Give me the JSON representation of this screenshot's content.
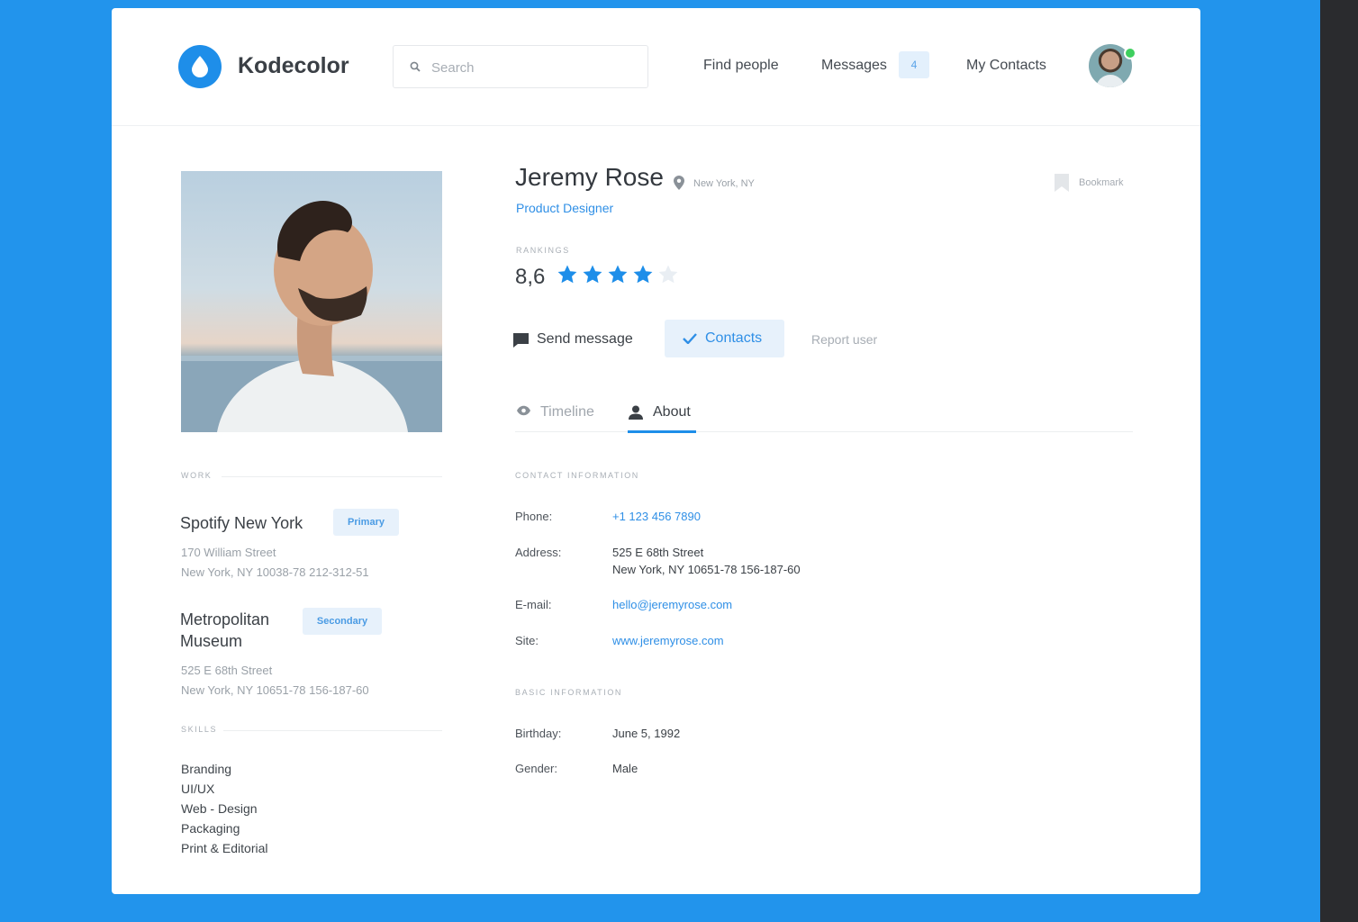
{
  "header": {
    "brand": "Kodecolor",
    "search_placeholder": "Search",
    "nav": {
      "find_people": "Find people",
      "messages": "Messages",
      "messages_count": "4",
      "my_contacts": "My Contacts"
    }
  },
  "profile": {
    "name": "Jeremy Rose",
    "location": "New York, NY",
    "job_title": "Product Designer",
    "bookmark_label": "Bookmark",
    "rankings_label": "RANKINGS",
    "ranking_value": "8,6",
    "stars_filled": 4,
    "stars_total": 5
  },
  "actions": {
    "send_message": "Send message",
    "contacts": "Contacts",
    "report_user": "Report user"
  },
  "tabs": [
    {
      "label": "Timeline",
      "active": false
    },
    {
      "label": "About",
      "active": true
    }
  ],
  "work": {
    "label": "WORK",
    "items": [
      {
        "name": "Spotify New York",
        "tag": "Primary",
        "address_line1": "170 William Street",
        "address_line2": "New York, NY 10038-78 212-312-51"
      },
      {
        "name_line1": "Metropolitan",
        "name_line2": "Museum",
        "tag": "Secondary",
        "address_line1": "525 E 68th Street",
        "address_line2": "New York, NY 10651-78 156-187-60"
      }
    ]
  },
  "skills": {
    "label": "SKILLS",
    "items": [
      "Branding",
      "UI/UX",
      "Web - Design",
      "Packaging",
      "Print & Editorial"
    ]
  },
  "contact": {
    "label": "CONTACT INFORMATION",
    "phone_label": "Phone:",
    "phone": "+1 123 456 7890",
    "address_label": "Address:",
    "address_line1": "525 E 68th Street",
    "address_line2": "New York, NY 10651-78 156-187-60",
    "email_label": "E-mail:",
    "email": "hello@jeremyrose.com",
    "site_label": "Site:",
    "site": "www.jeremyrose.com"
  },
  "basic": {
    "label": "BASIC INFORMATION",
    "birthday_label": "Birthday:",
    "birthday": "June 5, 1992",
    "gender_label": "Gender:",
    "gender": "Male"
  },
  "colors": {
    "background": "#2294ec",
    "accent": "#1e8ee9",
    "star_filled": "#1e8ee9",
    "star_empty": "#e9eef3",
    "online": "#3fcf5f"
  }
}
